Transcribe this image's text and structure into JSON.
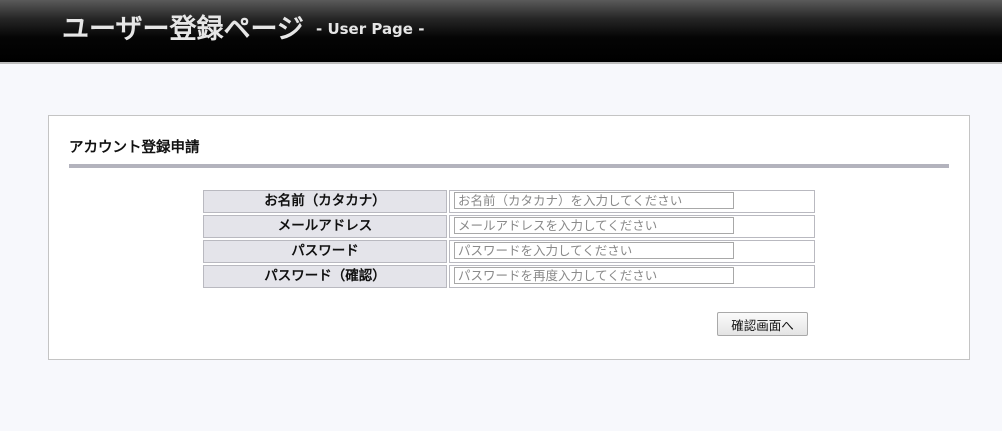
{
  "header": {
    "title": "ユーザー登録ページ",
    "subtitle": "- User Page -"
  },
  "panel": {
    "title": "アカウント登録申請"
  },
  "form": {
    "fields": [
      {
        "label": "お名前（カタカナ）",
        "value": "",
        "placeholder": "お名前（カタカナ）を入力してください"
      },
      {
        "label": "メールアドレス",
        "value": "",
        "placeholder": "メールアドレスを入力してください"
      },
      {
        "label": "パスワード",
        "value": "",
        "placeholder": "パスワードを入力してください"
      },
      {
        "label": "パスワード（確認）",
        "value": "",
        "placeholder": "パスワードを再度入力してください"
      }
    ],
    "submit_label": "確認画面へ"
  },
  "colors": {
    "header_bg": "#000000",
    "page_bg": "#f7f8fc",
    "label_bg": "#e4e4ea",
    "rule": "#b3b3bd"
  }
}
